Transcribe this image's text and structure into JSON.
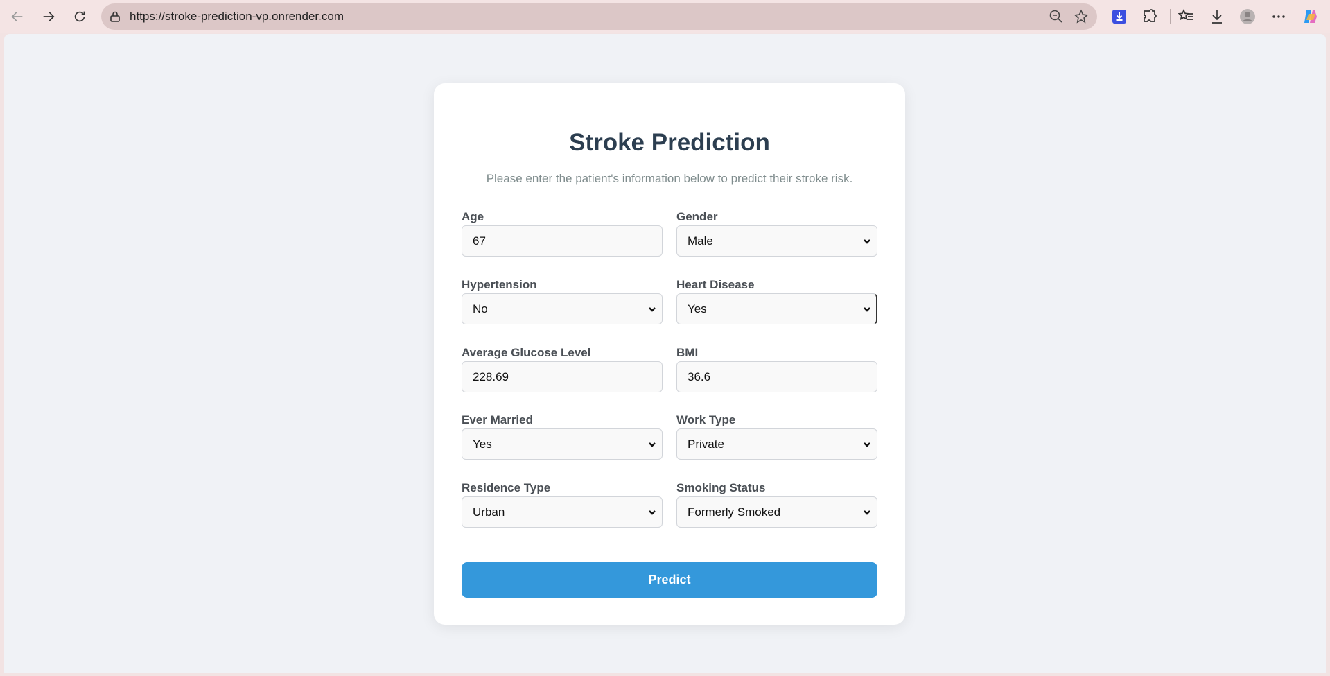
{
  "browser": {
    "url": "https://stroke-prediction-vp.onrender.com"
  },
  "form": {
    "title": "Stroke Prediction",
    "subtitle": "Please enter the patient's information below to predict their stroke risk.",
    "fields": {
      "age": {
        "label": "Age",
        "value": "67"
      },
      "gender": {
        "label": "Gender",
        "value": "Male"
      },
      "hypertension": {
        "label": "Hypertension",
        "value": "No"
      },
      "heart_disease": {
        "label": "Heart Disease",
        "value": "Yes"
      },
      "glucose": {
        "label": "Average Glucose Level",
        "value": "228.69"
      },
      "bmi": {
        "label": "BMI",
        "value": "36.6"
      },
      "ever_married": {
        "label": "Ever Married",
        "value": "Yes"
      },
      "work_type": {
        "label": "Work Type",
        "value": "Private"
      },
      "residence": {
        "label": "Residence Type",
        "value": "Urban"
      },
      "smoking": {
        "label": "Smoking Status",
        "value": "Formerly Smoked"
      }
    },
    "submit_label": "Predict"
  },
  "colors": {
    "accent": "#3498db",
    "title": "#2c3e50",
    "page_bg": "#f0f2f6",
    "chrome_bg": "#f4e4e4"
  }
}
